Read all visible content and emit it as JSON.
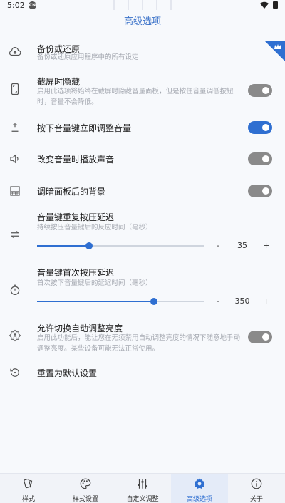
{
  "status_bar": {
    "time": "5:02",
    "app_badge": "CN"
  },
  "header": {
    "title": "高级选项"
  },
  "settings": {
    "backup": {
      "label": "备份或还原",
      "desc": "备份或还原应用程序中的所有设定"
    },
    "hide_screenshot": {
      "label": "截屏时隐藏",
      "desc": "启用此选项将始终在截屏时隐藏音量面板，但是按住音量调低按钮时，音量不会降低。",
      "enabled": false
    },
    "instant_adjust": {
      "label": "按下音量键立即调整音量",
      "enabled": true
    },
    "play_sound": {
      "label": "改变音量时播放声音",
      "enabled": false
    },
    "dim_background": {
      "label": "调暗面板后的背景",
      "enabled": false
    },
    "repeat_delay": {
      "label": "音量键重复按压延迟",
      "desc": "持续按压音量键后的反应时间（毫秒）",
      "value": "35",
      "minus": "-",
      "plus": "+",
      "level": 0.31
    },
    "first_delay": {
      "label": "音量键首次按压延迟",
      "desc": "首次按下音量键后的延迟时间（毫秒）",
      "value": "350",
      "minus": "-",
      "plus": "+",
      "level": 0.7
    },
    "auto_brightness": {
      "label": "允许切换自动调整亮度",
      "desc": "启用此功能后，能让您在无须禁用自动调整亮度的情况下随意地手动调整亮度。某些设备可能无法正常使用。",
      "enabled": false
    },
    "reset": {
      "label": "重置为默认设置"
    }
  },
  "bottom_nav": {
    "items": [
      {
        "label": "样式",
        "icon": "style-icon"
      },
      {
        "label": "样式设置",
        "icon": "palette-icon"
      },
      {
        "label": "自定义调整",
        "icon": "tune-icon"
      },
      {
        "label": "高级选项",
        "icon": "gear-icon",
        "active": true
      },
      {
        "label": "关于",
        "icon": "info-icon"
      }
    ]
  },
  "colors": {
    "accent": "#2f6fd1",
    "title": "#3b72c9",
    "switch_off": "#8a8a8a"
  }
}
